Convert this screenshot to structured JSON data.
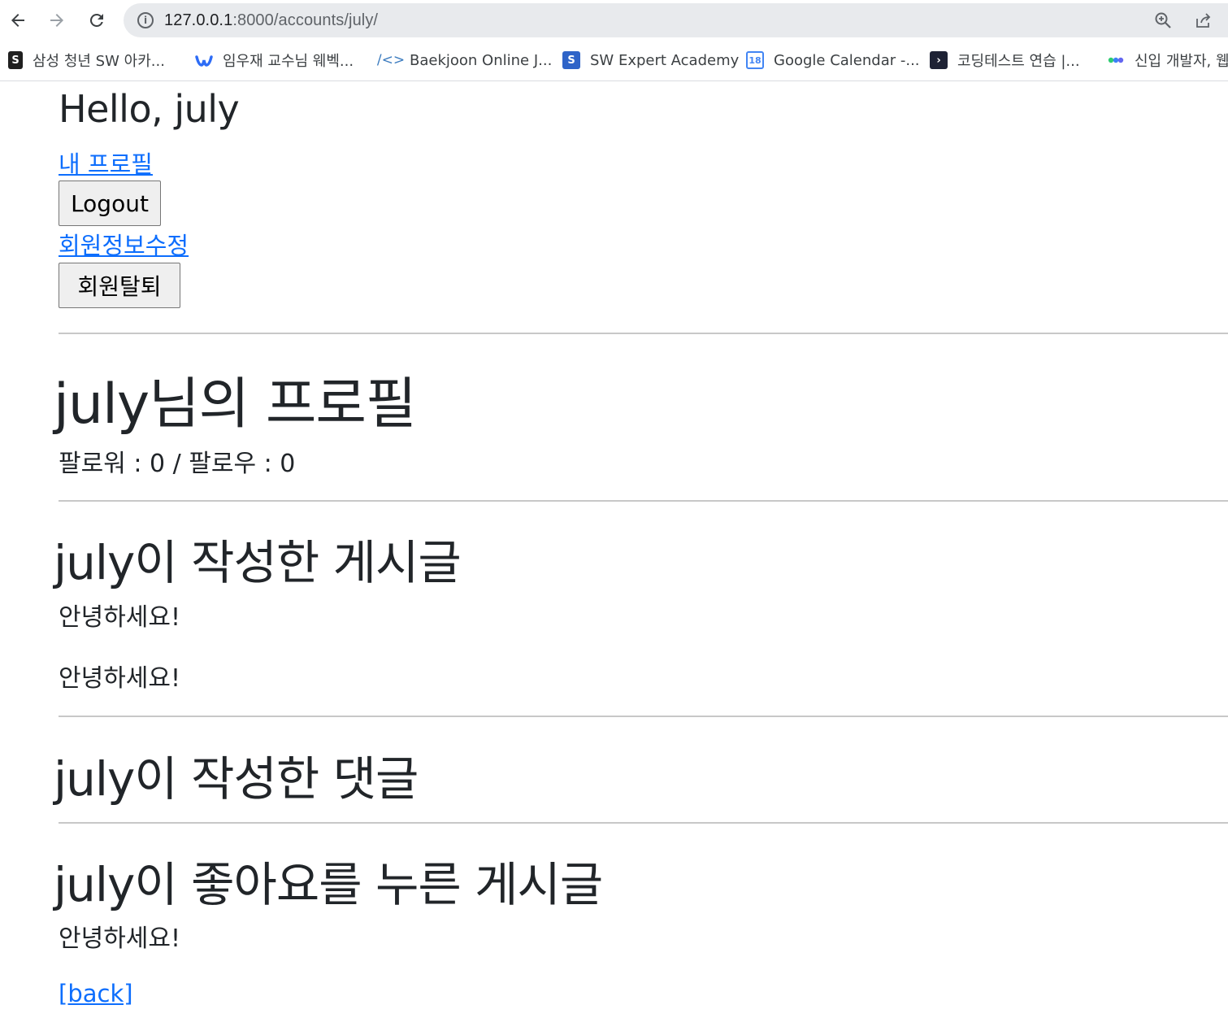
{
  "browser": {
    "url_host": "127.0.0.1",
    "url_rest": ":8000/accounts/july/",
    "bookmarks": [
      {
        "label": "삼성 청년 SW 아카...",
        "icon": "samsung-ssafy-icon",
        "color": "#1f1f1f"
      },
      {
        "label": "임우재 교수님 웨벡...",
        "icon": "webex-icon",
        "color": "#2d6cf6"
      },
      {
        "label": "Baekjoon Online J...",
        "icon": "code-brackets-icon",
        "color": "#3b7bbf"
      },
      {
        "label": "SW Expert Academy",
        "icon": "swea-icon",
        "color": "#2f64c8"
      },
      {
        "label": "Google Calendar -...",
        "icon": "calendar-icon",
        "color": "#4285f4"
      },
      {
        "label": "코딩테스트 연습 |...",
        "icon": "programmers-icon",
        "color": "#1e2235"
      },
      {
        "label": "신입 개발자, 웹",
        "icon": "dots-icon",
        "color": "#3b82f6"
      }
    ]
  },
  "page": {
    "greeting": "Hello, july",
    "my_profile_link": "내 프로필",
    "logout_button": "Logout",
    "edit_account_link": "회원정보수정",
    "delete_account_button": "회원탈퇴",
    "profile_title": "july님의 프로필",
    "follow_info": "팔로워 : 0 / 팔로우 : 0",
    "articles_title": "july이 작성한 게시글",
    "articles": [
      "안녕하세요!",
      "안녕하세요!"
    ],
    "comments_title": "july이 작성한 댓글",
    "liked_title": "july이 좋아요를 누른 게시글",
    "liked_articles": [
      "안녕하세요!"
    ],
    "back_link": "[back]"
  }
}
